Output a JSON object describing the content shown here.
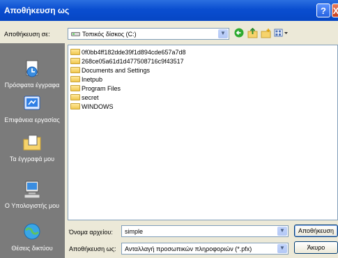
{
  "window": {
    "title": "Αποθήκευση ως"
  },
  "titlebar": {
    "help": "?",
    "close": "X"
  },
  "toolbar": {
    "save_in_label": "Αποθήκευση σε:",
    "location": "Τοπικός δίσκος (C:)",
    "back_icon": "back-icon",
    "up_icon": "up-folder-icon",
    "new_folder_icon": "new-folder-icon",
    "view_icon": "view-menu-icon"
  },
  "places": [
    {
      "label": "Πρόσφατα έγγραφα",
      "icon": "recent-documents-icon"
    },
    {
      "label": "Επιφάνεια εργασίας",
      "icon": "desktop-icon"
    },
    {
      "label": "Τα έγγραφά μου",
      "icon": "my-documents-icon"
    },
    {
      "label": "Ο Υπολογιστής μου",
      "icon": "my-computer-icon"
    },
    {
      "label": "Θέσεις δικτύου",
      "icon": "network-places-icon"
    }
  ],
  "files": [
    {
      "name": "0f0bb4ff182dde39f1d894cde657a7d8"
    },
    {
      "name": "268ce05a61d1d477508716c9f43517"
    },
    {
      "name": "Documents and Settings"
    },
    {
      "name": "Inetpub"
    },
    {
      "name": "Program Files"
    },
    {
      "name": "secret"
    },
    {
      "name": "WINDOWS"
    }
  ],
  "form": {
    "filename_label": "Όνομα αρχείου:",
    "filename_value": "simple",
    "savetype_label": "Αποθήκευση ως:",
    "savetype_value": "Ανταλλαγή προσωπικών πληροφοριών (*.pfx)",
    "save_button": "Αποθήκευση",
    "cancel_button": "Άκυρο"
  }
}
